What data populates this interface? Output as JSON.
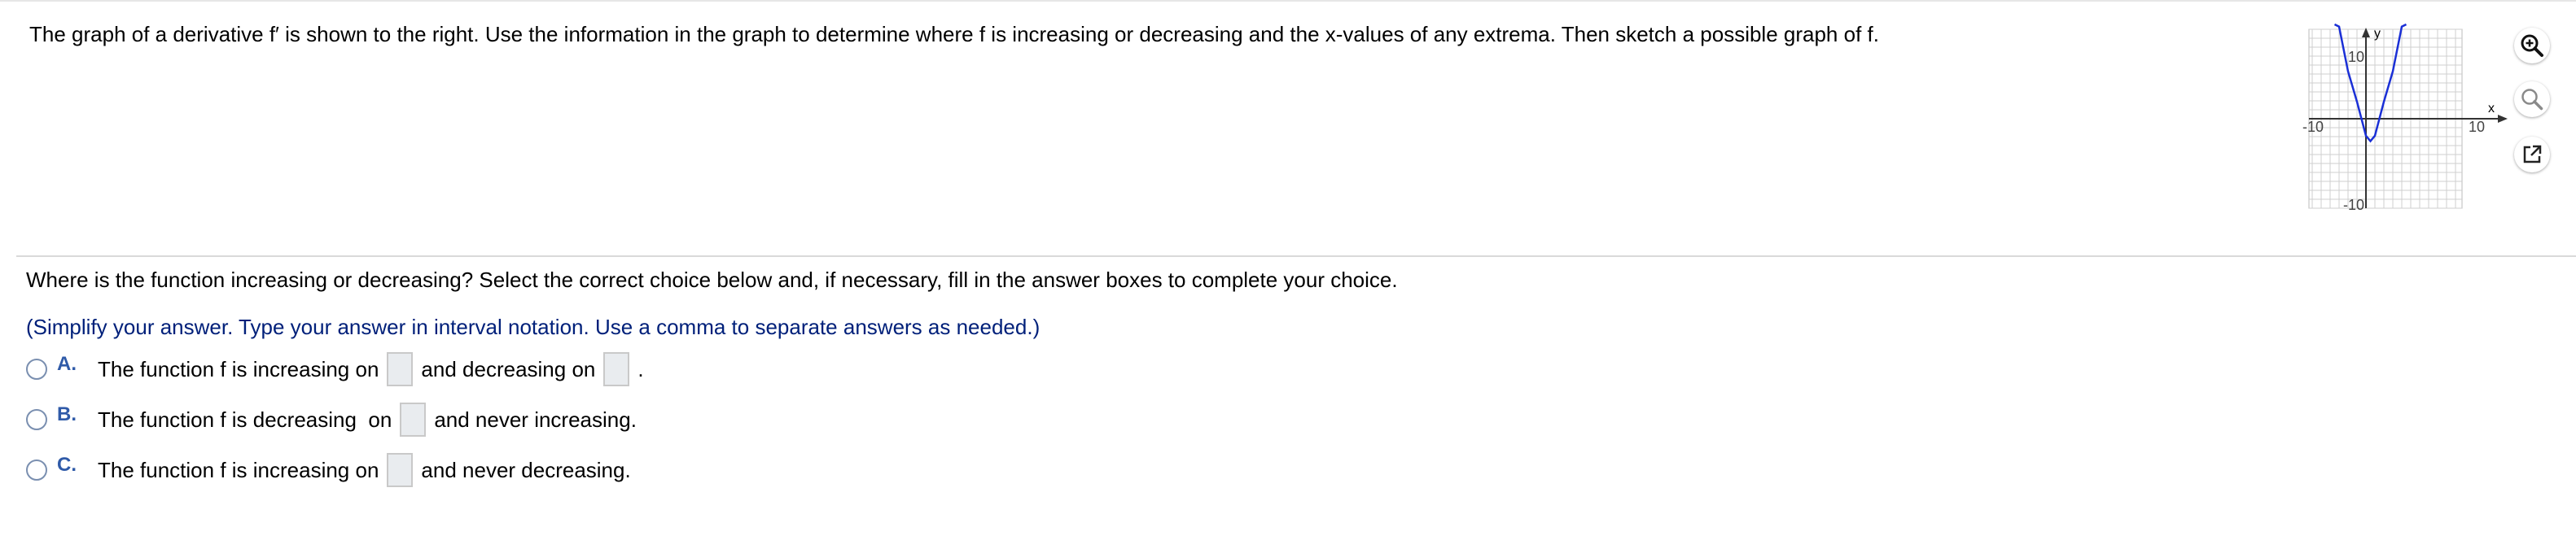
{
  "question": {
    "text": "The graph of a derivative f′ is shown to the right. Use the information in the graph to determine where f is increasing or decreasing and the x-values of any extrema. Then sketch a possible graph of f."
  },
  "graph": {
    "y_axis_label": "y",
    "x_axis_label": "x",
    "y_top_tick": "10",
    "y_bottom_tick": "-10",
    "x_left_tick": "-10",
    "x_right_tick": "10",
    "curve_color": "#1a2fd6",
    "chart_data": {
      "type": "line",
      "description_function": "parabola f'(x), vertex near (0.5, -2.5)",
      "x": [
        -3.5,
        -3,
        -2,
        -1,
        0,
        0.5,
        1,
        2,
        3,
        4,
        4.5
      ],
      "y": [
        13.5,
        10.3,
        5.3,
        1.9,
        -1.9,
        -2.5,
        -1.9,
        1.9,
        5.3,
        10.3,
        13.5
      ],
      "xlim": [
        -10,
        10
      ],
      "ylim": [
        -10,
        10
      ],
      "grid": true
    }
  },
  "tools": {
    "zoom_in": "zoom-in",
    "zoom_out": "zoom-out",
    "popout": "open-in-new-window"
  },
  "prompt": {
    "text": "Where is the function increasing or decreasing? Select the correct choice below and, if necessary, fill in the answer boxes to complete your choice."
  },
  "hint": {
    "text": "(Simplify your answer. Type your answer in interval notation. Use a comma to separate answers as needed.)"
  },
  "choices": [
    {
      "letter": "A.",
      "before": "The function f is increasing on",
      "middle": "and decreasing on",
      "after": "."
    },
    {
      "letter": "B.",
      "before": "The function f is decreasing  on",
      "after": "and never increasing."
    },
    {
      "letter": "C.",
      "before": "The function f is increasing on",
      "after": "and never decreasing."
    }
  ]
}
